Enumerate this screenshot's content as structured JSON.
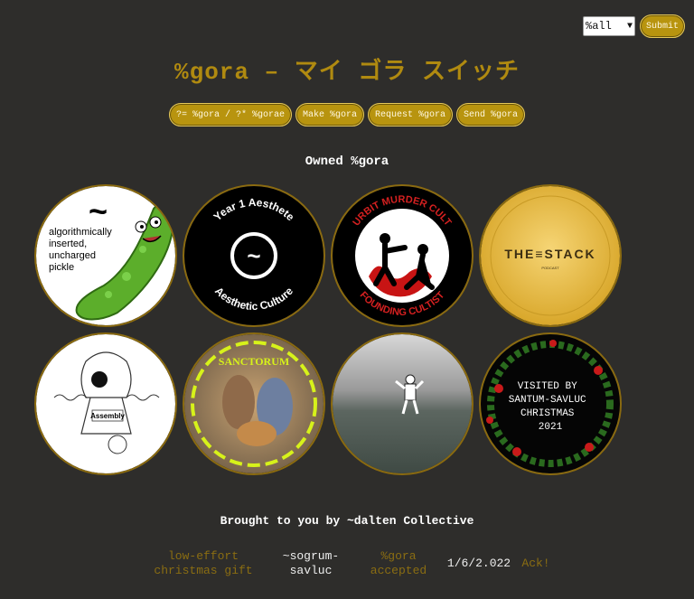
{
  "filter": {
    "selected": "%all"
  },
  "submit_label": "Submit",
  "title": "%gora – マイ ゴラ スイッチ",
  "actions": [
    "?= %gora / ?* %gorae",
    "Make %gora",
    "Request %gora",
    "Send %gora"
  ],
  "section_heading": "Owned %gora",
  "badges": [
    {
      "name": "pickle",
      "tilde": "~",
      "lines": [
        "algorithmically",
        "inserted,",
        "uncharged",
        "pickle"
      ]
    },
    {
      "name": "aesthete",
      "top": "Year 1 Aesthete",
      "bottom": "Aesthetic Culture",
      "tilde": "~"
    },
    {
      "name": "murder-cult",
      "top": "URBIT MURDER CULT",
      "bottom": "FOUNDING CULTIST"
    },
    {
      "name": "stack",
      "text": "THE≡STACK",
      "sub": "PODCAST"
    },
    {
      "name": "assembly",
      "text": "Assembly"
    },
    {
      "name": "sanctorum",
      "text": "SANCTORUM"
    },
    {
      "name": "astronaut"
    },
    {
      "name": "christmas",
      "lines": [
        "VISITED BY",
        "SANTUM-SAVLUC",
        "CHRISTMAS",
        "2021"
      ]
    }
  ],
  "credit": "Brought to you by ~dalten Collective",
  "notification": {
    "desc_lines": [
      "low-effort",
      "christmas gift"
    ],
    "sender_lines": [
      "~sogrum-",
      "savluc"
    ],
    "status_lines": [
      "%gora",
      "accepted"
    ],
    "date": "1/6/2.022",
    "ack": "Ack!"
  },
  "colors": {
    "background": "#2e2d2b",
    "gold": "#b08a10",
    "pill": "#b8940f"
  }
}
